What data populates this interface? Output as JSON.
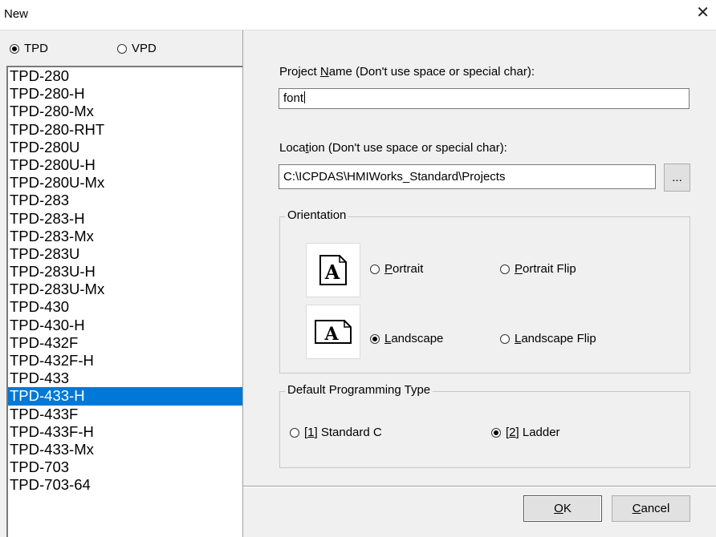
{
  "window": {
    "title": "New"
  },
  "device_family": {
    "option_tpd": "TPD",
    "option_vpd": "VPD",
    "selected": "TPD"
  },
  "models": [
    "TPD-280",
    "TPD-280-H",
    "TPD-280-Mx",
    "TPD-280-RHT",
    "TPD-280U",
    "TPD-280U-H",
    "TPD-280U-Mx",
    "TPD-283",
    "TPD-283-H",
    "TPD-283-Mx",
    "TPD-283U",
    "TPD-283U-H",
    "TPD-283U-Mx",
    "TPD-430",
    "TPD-430-H",
    "TPD-432F",
    "TPD-432F-H",
    "TPD-433",
    "TPD-433-H",
    "TPD-433F",
    "TPD-433F-H",
    "TPD-433-Mx",
    "TPD-703",
    "TPD-703-64"
  ],
  "selected_model": "TPD-433-H",
  "project_name": {
    "label_pre": "Project ",
    "label_key": "N",
    "label_post": "ame (Don't use space or special char):",
    "value": "font"
  },
  "location": {
    "label_pre": "Loca",
    "label_key": "t",
    "label_post": "ion (Don't use space or special char):",
    "value": "C:\\ICPDAS\\HMIWorks_Standard\\Projects",
    "browse_label": "..."
  },
  "orientation": {
    "title": "Orientation",
    "icon_glyph": "A",
    "portrait_key": "P",
    "portrait_rest": "ortrait",
    "portrait_flip_key": "P",
    "portrait_flip_rest": "ortrait Flip",
    "landscape_key": "L",
    "landscape_rest": "andscape",
    "landscape_flip_key": "L",
    "landscape_flip_rest": "andscape Flip",
    "selected": "Landscape"
  },
  "programming_type": {
    "title": "Default Programming Type",
    "standard_c_pre": "[",
    "standard_c_key": "1",
    "standard_c_post": "] Standard C",
    "ladder_pre": "[",
    "ladder_key": "2",
    "ladder_post": "] Ladder",
    "selected": "Ladder"
  },
  "buttons": {
    "ok_key": "O",
    "ok_rest": "K",
    "cancel_key": "C",
    "cancel_rest": "ancel"
  },
  "colors": {
    "selection": "#0078d7",
    "dialog_bg": "#f0f0f0"
  },
  "icons": {
    "close": "close-icon",
    "portrait": "portrait-page-icon",
    "landscape": "landscape-page-icon"
  }
}
